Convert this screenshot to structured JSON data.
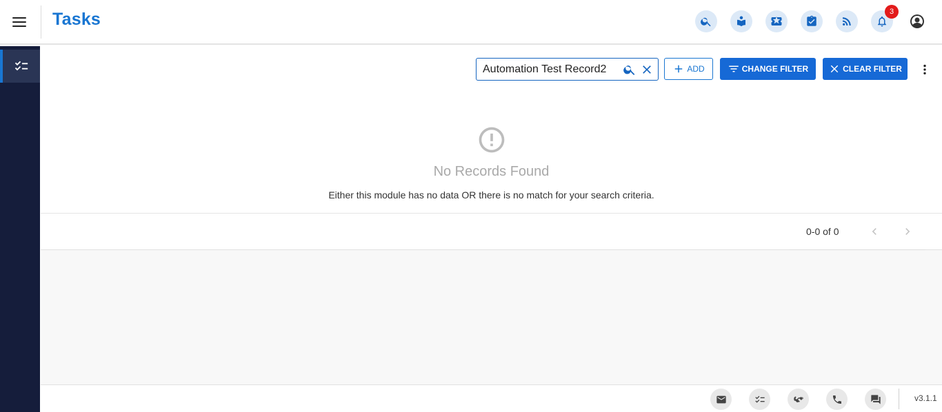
{
  "header": {
    "title": "Tasks",
    "notification_count": "3",
    "icons": [
      "search-icon",
      "reader-icon",
      "ticket-icon",
      "clipboard-check-icon",
      "rss-icon",
      "bell-icon",
      "account-icon"
    ]
  },
  "sidebar": {
    "items": [
      {
        "icon": "checklist-icon",
        "active": true
      }
    ]
  },
  "toolbar": {
    "search_value": "Automation Test Record2",
    "add_label": "ADD",
    "change_filter_label": "CHANGE FILTER",
    "clear_filter_label": "CLEAR FILTER"
  },
  "empty_state": {
    "title": "No Records Found",
    "description": "Either this module has no data OR there is no match for your search criteria."
  },
  "pagination": {
    "range": "0-0 of 0"
  },
  "footer": {
    "icons": [
      "email-icon",
      "checklist-icon",
      "handshake-icon",
      "phone-icon",
      "chat-icon"
    ],
    "version": "v3.1.1"
  },
  "colors": {
    "primary": "#1669d6",
    "sidebar_bg": "#151d3b",
    "badge": "#e31b1b"
  }
}
